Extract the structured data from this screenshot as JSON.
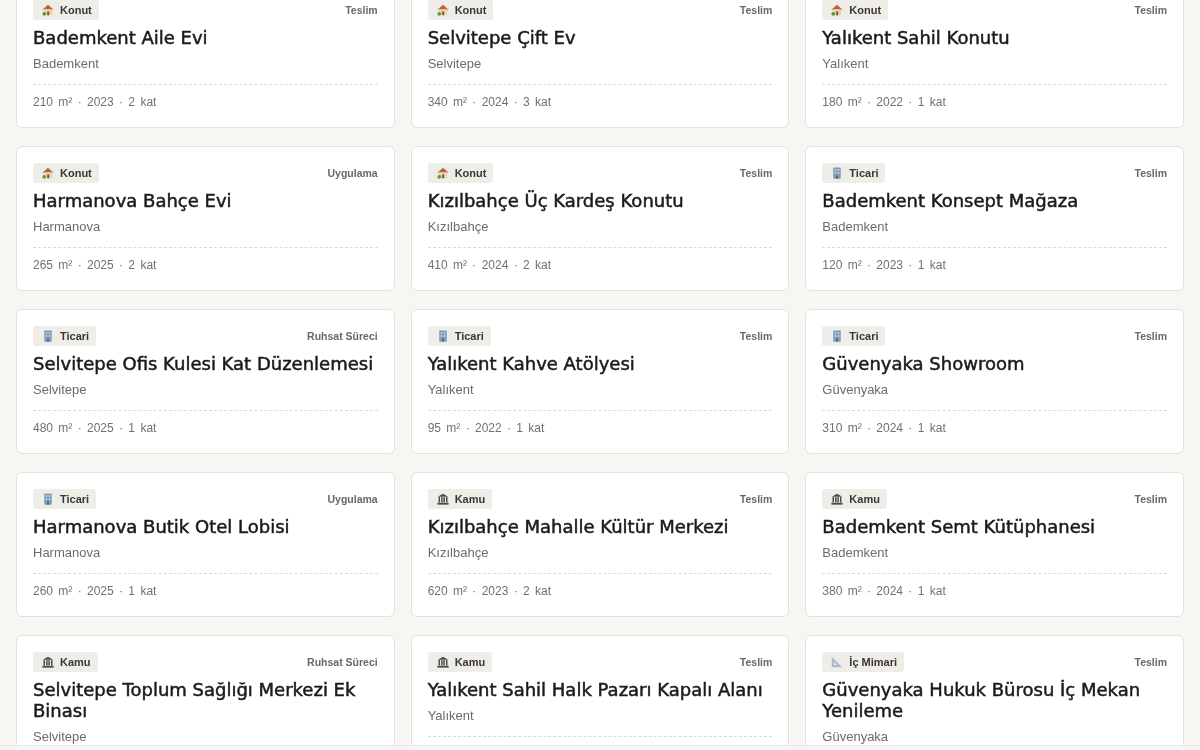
{
  "projects": [
    {
      "category": {
        "kind": "residential",
        "label": "Konut"
      },
      "status": "Teslim",
      "title": "Bademkent Aile Evi",
      "location": "Bademkent",
      "details": "210 m² · 2023 · 2 kat"
    },
    {
      "category": {
        "kind": "residential",
        "label": "Konut"
      },
      "status": "Teslim",
      "title": "Selvitepe Çift Ev",
      "location": "Selvitepe",
      "details": "340 m² · 2024 · 3 kat"
    },
    {
      "category": {
        "kind": "residential",
        "label": "Konut"
      },
      "status": "Teslim",
      "title": "Yalıkent Sahil Konutu",
      "location": "Yalıkent",
      "details": "180 m² · 2022 · 1 kat"
    },
    {
      "category": {
        "kind": "residential",
        "label": "Konut"
      },
      "status": "Uygulama",
      "title": "Harmanova Bahçe Evi",
      "location": "Harmanova",
      "details": "265 m² · 2025 · 2 kat"
    },
    {
      "category": {
        "kind": "residential",
        "label": "Konut"
      },
      "status": "Teslim",
      "title": "Kızılbahçe Üç Kardeş Konutu",
      "location": "Kızılbahçe",
      "details": "410 m² · 2024 · 2 kat"
    },
    {
      "category": {
        "kind": "commercial",
        "label": "Ticari"
      },
      "status": "Teslim",
      "title": "Bademkent Konsept Mağaza",
      "location": "Bademkent",
      "details": "120 m² · 2023 · 1 kat"
    },
    {
      "category": {
        "kind": "commercial",
        "label": "Ticari"
      },
      "status": "Ruhsat Süreci",
      "title": "Selvitepe Ofis Kulesi Kat Düzenlemesi",
      "location": "Selvitepe",
      "details": "480 m² · 2025 · 1 kat"
    },
    {
      "category": {
        "kind": "commercial",
        "label": "Ticari"
      },
      "status": "Teslim",
      "title": "Yalıkent Kahve Atölyesi",
      "location": "Yalıkent",
      "details": "95 m² · 2022 · 1 kat"
    },
    {
      "category": {
        "kind": "commercial",
        "label": "Ticari"
      },
      "status": "Teslim",
      "title": "Güvenyaka Showroom",
      "location": "Güvenyaka",
      "details": "310 m² · 2024 · 1 kat"
    },
    {
      "category": {
        "kind": "commercial",
        "label": "Ticari"
      },
      "status": "Uygulama",
      "title": "Harmanova Butik Otel Lobisi",
      "location": "Harmanova",
      "details": "260 m² · 2025 · 1 kat"
    },
    {
      "category": {
        "kind": "public",
        "label": "Kamu"
      },
      "status": "Teslim",
      "title": "Kızılbahçe Mahalle Kültür Merkezi",
      "location": "Kızılbahçe",
      "details": "620 m² · 2023 · 2 kat"
    },
    {
      "category": {
        "kind": "public",
        "label": "Kamu"
      },
      "status": "Teslim",
      "title": "Bademkent Semt Kütüphanesi",
      "location": "Bademkent",
      "details": "380 m² · 2024 · 1 kat"
    },
    {
      "category": {
        "kind": "public",
        "label": "Kamu"
      },
      "status": "Ruhsat Süreci",
      "title": "Selvitepe Toplum Sağlığı Merkezi Ek Binası",
      "location": "Selvitepe"
    },
    {
      "category": {
        "kind": "public",
        "label": "Kamu"
      },
      "status": "Teslim",
      "title": "Yalıkent Sahil Halk Pazarı Kapalı Alanı",
      "location": "Yalıkent"
    },
    {
      "category": {
        "kind": "interior",
        "label": "İç Mimari"
      },
      "status": "Teslim",
      "title": "Güvenyaka Hukuk Bürosu İç Mekan Yenileme",
      "location": "Güvenyaka"
    }
  ]
}
